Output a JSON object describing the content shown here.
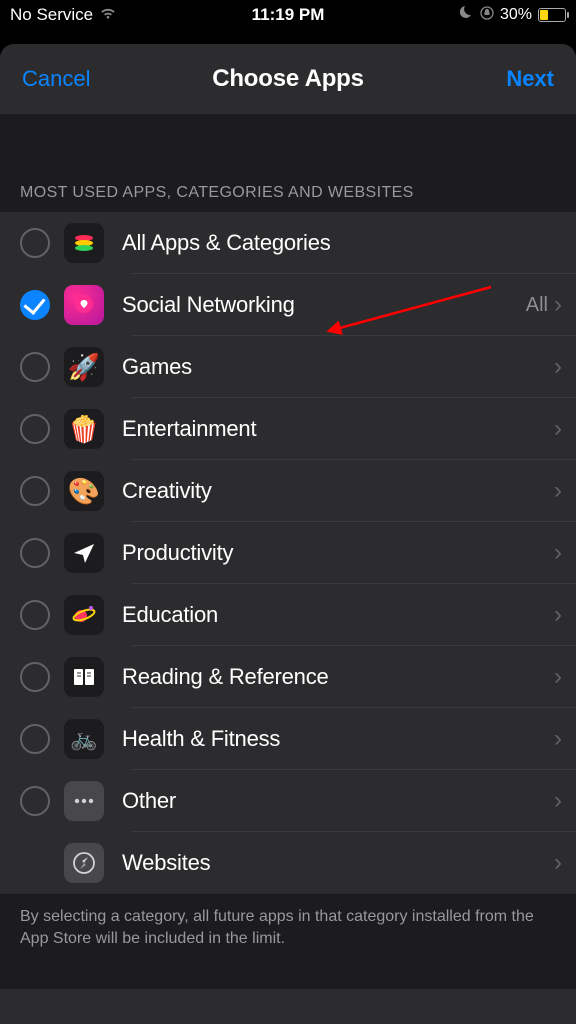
{
  "status": {
    "carrier": "No Service",
    "time": "11:19 PM",
    "battery_pct": "30%"
  },
  "sheet": {
    "cancel": "Cancel",
    "title": "Choose Apps",
    "next": "Next"
  },
  "section": {
    "header": "MOST USED APPS, CATEGORIES AND WEBSITES"
  },
  "rows": [
    {
      "label": "All Apps & Categories",
      "icon": "stack",
      "checked": false,
      "chevron": false,
      "trail": ""
    },
    {
      "label": "Social Networking",
      "icon": "social",
      "checked": true,
      "chevron": true,
      "trail": "All"
    },
    {
      "label": "Games",
      "icon": "games",
      "checked": false,
      "chevron": true,
      "trail": ""
    },
    {
      "label": "Entertainment",
      "icon": "ent",
      "checked": false,
      "chevron": true,
      "trail": ""
    },
    {
      "label": "Creativity",
      "icon": "creat",
      "checked": false,
      "chevron": true,
      "trail": ""
    },
    {
      "label": "Productivity",
      "icon": "prod",
      "checked": false,
      "chevron": true,
      "trail": ""
    },
    {
      "label": "Education",
      "icon": "edu",
      "checked": false,
      "chevron": true,
      "trail": ""
    },
    {
      "label": "Reading & Reference",
      "icon": "read",
      "checked": false,
      "chevron": true,
      "trail": ""
    },
    {
      "label": "Health & Fitness",
      "icon": "health",
      "checked": false,
      "chevron": true,
      "trail": ""
    },
    {
      "label": "Other",
      "icon": "other",
      "checked": false,
      "chevron": true,
      "trail": ""
    },
    {
      "label": "Websites",
      "icon": "web",
      "checked": null,
      "chevron": true,
      "trail": ""
    }
  ],
  "footer": "By selecting a category, all future apps in that category installed from the App Store will be included in the limit."
}
